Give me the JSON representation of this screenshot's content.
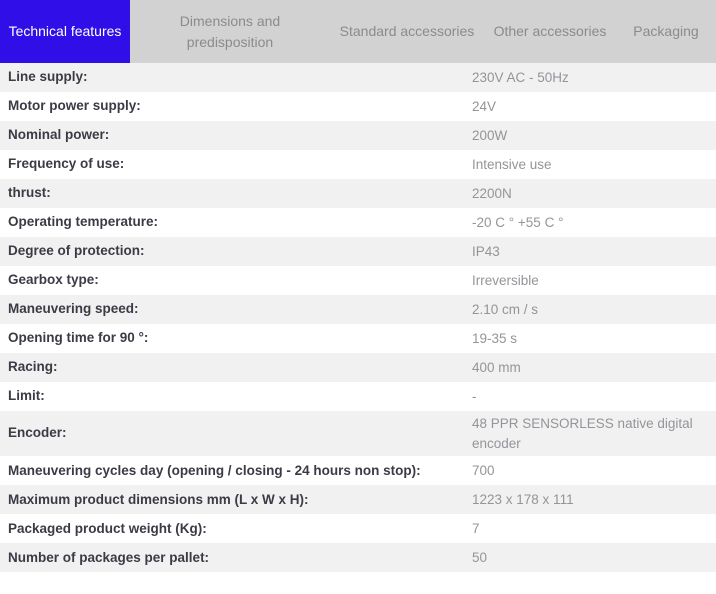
{
  "colors": {
    "active_tab_bg": "#300ee8",
    "active_tab_text": "#ffffff",
    "tab_bar_bg": "#d2d2d2",
    "inactive_tab_text": "#8b8b8b",
    "alt_row_bg": "#f1f1f1",
    "label_text": "#3e3a45",
    "value_text": "#969399"
  },
  "tabs": [
    {
      "name": "tab-technical-features",
      "label": "Technical features",
      "active": true
    },
    {
      "name": "tab-dimensions-and-predisposition",
      "label": "Dimensions and predisposition",
      "active": false
    },
    {
      "name": "tab-standard-accessories",
      "label": "Standard accessories",
      "active": false
    },
    {
      "name": "tab-other-accessories",
      "label": "Other accessories",
      "active": false
    },
    {
      "name": "tab-packaging",
      "label": "Packaging",
      "active": false
    }
  ],
  "table": {
    "rows": [
      {
        "label": "Line supply:",
        "value": "230V AC - 50Hz"
      },
      {
        "label": "Motor power supply:",
        "value": "24V"
      },
      {
        "label": "Nominal power:",
        "value": "200W"
      },
      {
        "label": "Frequency of use:",
        "value": "Intensive use"
      },
      {
        "label": "thrust:",
        "value": "2200N"
      },
      {
        "label": "Operating temperature:",
        "value": "-20 C ° +55 C °"
      },
      {
        "label": "Degree of protection:",
        "value": "IP43"
      },
      {
        "label": "Gearbox type:",
        "value": "Irreversible"
      },
      {
        "label": "Maneuvering speed:",
        "value": "2.10 cm / s"
      },
      {
        "label": "Opening time for 90 °:",
        "value": "19-35 s"
      },
      {
        "label": "Racing:",
        "value": "400 mm"
      },
      {
        "label": "Limit:",
        "value": "-"
      },
      {
        "label": "Encoder:",
        "value": "48 PPR SENSORLESS native digital encoder"
      },
      {
        "label": "Maneuvering cycles day (opening / closing - 24 hours non stop):",
        "value": "700"
      },
      {
        "label": "Maximum product dimensions mm (L x W x H):",
        "value": "1223 x 178 x 111"
      },
      {
        "label": "Packaged product weight (Kg):",
        "value": "7"
      },
      {
        "label": "Number of packages per pallet:",
        "value": "50"
      }
    ]
  }
}
